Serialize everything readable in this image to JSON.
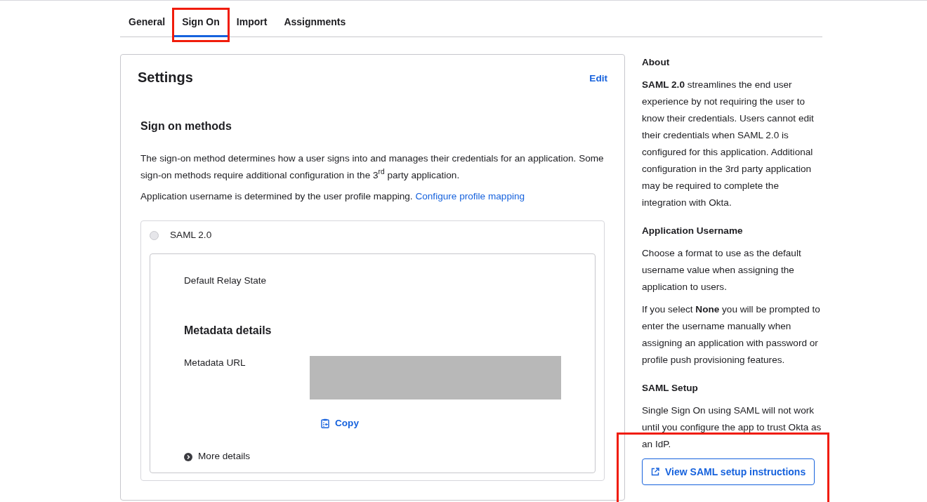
{
  "tabs": [
    {
      "label": "General",
      "selected": false,
      "highlighted": false
    },
    {
      "label": "Sign On",
      "selected": true,
      "highlighted": true
    },
    {
      "label": "Import",
      "selected": false,
      "highlighted": false
    },
    {
      "label": "Assignments",
      "selected": false,
      "highlighted": false
    }
  ],
  "settings": {
    "title": "Settings",
    "edit_link": "Edit",
    "section_title": "Sign on methods",
    "description": "The sign-on method determines how a user signs into and manages their credentials for an application. Some sign-on methods require additional configuration in the 3$^{rd}$ party application.",
    "username_note": "Application username is determined by the user profile mapping.",
    "username_link": "Configure profile mapping",
    "methods": [
      {
        "label": "SAML 2.0",
        "selected": false,
        "disabled": true,
        "relay_state_label": "Default Relay State",
        "metadata_title": "Metadata details",
        "metadata_url_label": "Metadata URL",
        "redacted": true,
        "copy_label": "Copy",
        "more_details": "More details",
        "more_expanded": false
      }
    ]
  },
  "sidebar": {
    "sections": [
      {
        "title": "About",
        "paragraphs": [
          "**SAML 2.0** streamlines the end user experience by not requiring the user to know their credentials. Users cannot edit their credentials when SAML 2.0 is configured for this application. Additional configuration in the 3rd party application may be required to complete the integration with Okta."
        ]
      },
      {
        "title": "Application Username",
        "paragraphs": [
          "Choose a format to use as the default username value when assigning the application to users.",
          "If you select **None** you will be prompted to enter the username manually when assigning an application with password or profile push provisioning features."
        ]
      },
      {
        "title": "SAML Setup",
        "paragraphs": [
          "Single Sign On using SAML will not work until you configure the app to trust Okta as an IdP."
        ],
        "button": {
          "label": "View SAML setup instructions",
          "highlighted": true
        }
      }
    ]
  }
}
